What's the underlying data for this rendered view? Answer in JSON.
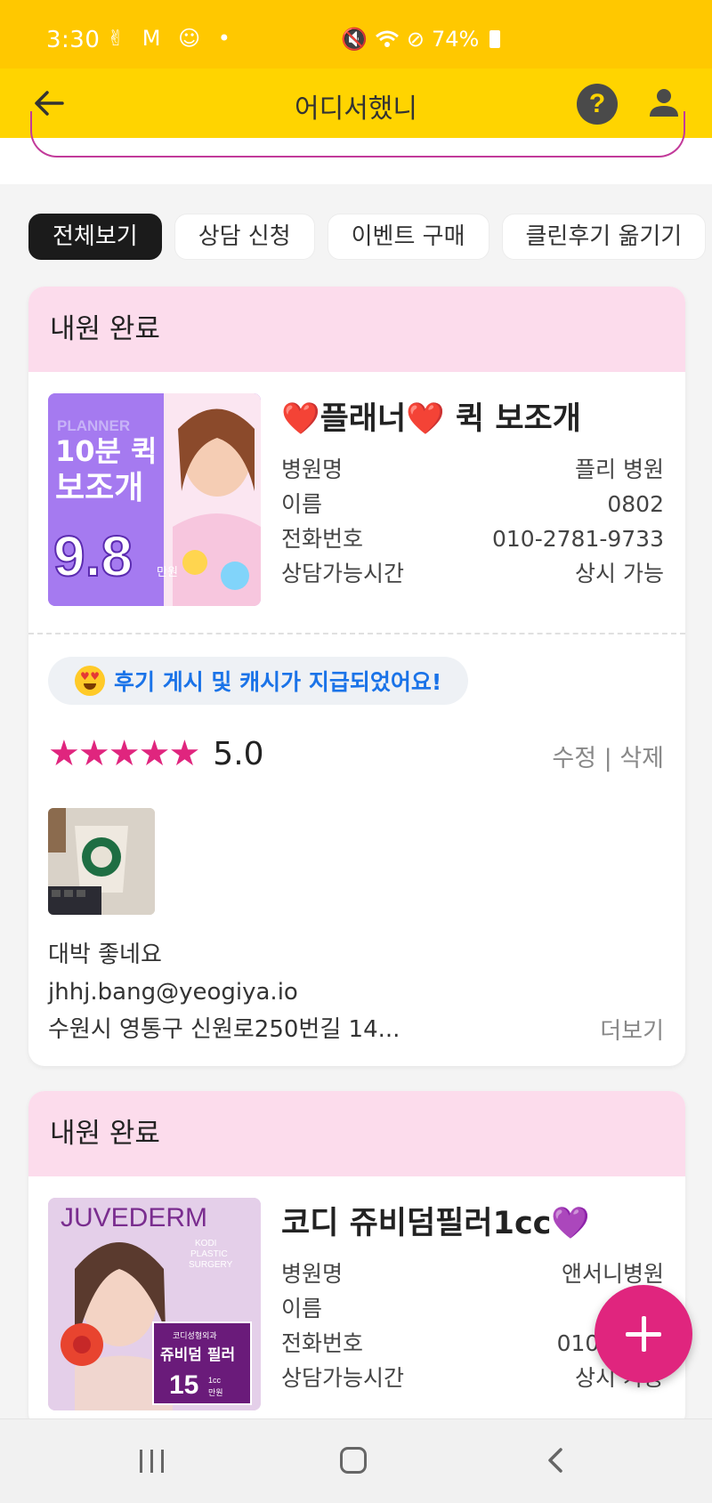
{
  "status_bar": {
    "time": "3:30",
    "left_icons": "✌ M ☺ •",
    "battery": "74%"
  },
  "app_bar": {
    "title": "어디서했니",
    "help_label": "?"
  },
  "filters": [
    {
      "label": "전체보기",
      "active": true
    },
    {
      "label": "상담 신청",
      "active": false
    },
    {
      "label": "이벤트 구매",
      "active": false
    },
    {
      "label": "클린후기 옮기기",
      "active": false
    }
  ],
  "cards": [
    {
      "status": "내원 완료",
      "title": "❤️플래너❤️ 퀵 보조개",
      "thumb_text": {
        "line0": "PLANNER",
        "line1": "10분 퀵",
        "line2": "보조개",
        "price": "9.8",
        "unit": "만원"
      },
      "info": [
        {
          "label": "병원명",
          "value": "플리 병원"
        },
        {
          "label": "이름",
          "value": "0802"
        },
        {
          "label": "전화번호",
          "value": "010-2781-9733"
        },
        {
          "label": "상담가능시간",
          "value": "상시 가능"
        }
      ],
      "notice": "후기 게시 및 캐시가 지급되었어요!",
      "rating": {
        "stars": 5,
        "value": "5.0"
      },
      "actions": "수정 | 삭제",
      "review_text": "대박 좋네요",
      "email": "jhhj.bang@yeogiya.io",
      "address": "수원시 영통구 신원로250번길 14...",
      "more": "더보기"
    },
    {
      "status": "내원 완료",
      "title": "코디 쥬비덤필러1cc💜",
      "thumb_text": {
        "brand": "JUVEDERM",
        "sub1": "KODI",
        "sub2": "PLASTIC",
        "sub3": "SURGERY",
        "box1": "코디성형외과",
        "box2": "쥬비덤 필러",
        "box3": "15",
        "box4": "1cc",
        "box5": "만원"
      },
      "info": [
        {
          "label": "병원명",
          "value": "앤서니병원"
        },
        {
          "label": "이름",
          "value": ""
        },
        {
          "label": "전화번호",
          "value": "010-2781"
        },
        {
          "label": "상담가능시간",
          "value": "상시 가능"
        }
      ]
    }
  ],
  "colors": {
    "status_bar": "#ffc800",
    "app_bar": "#ffd400",
    "card_header": "#fcdcec",
    "accent_pink": "#e0257e",
    "notice_blue": "#1a73e8"
  }
}
